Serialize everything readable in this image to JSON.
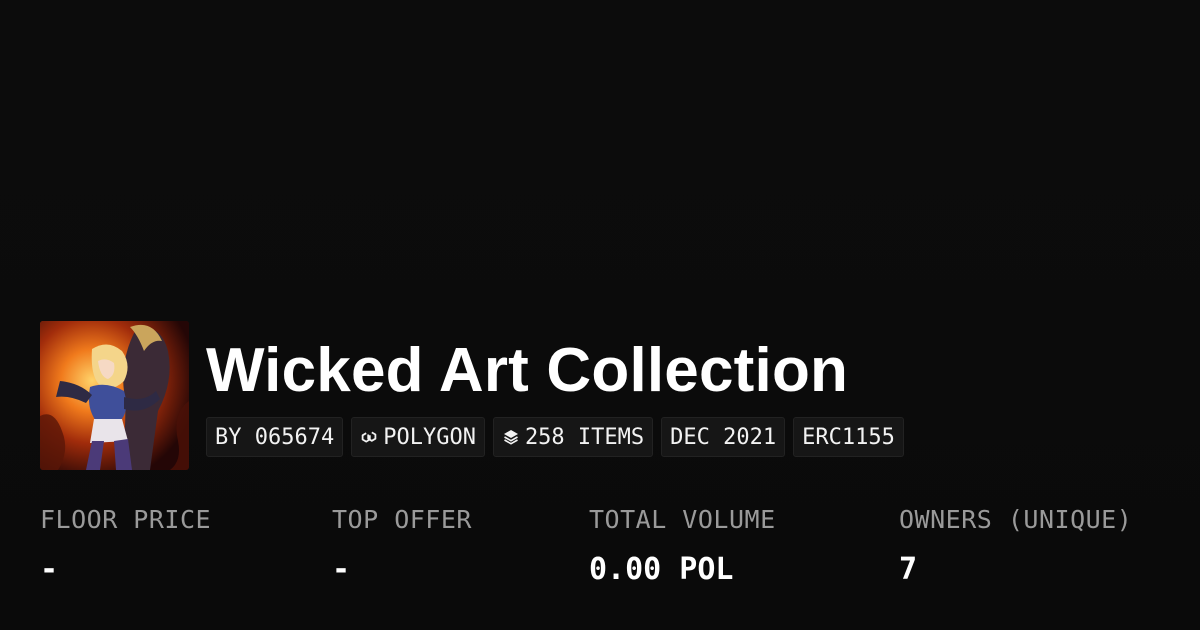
{
  "collection": {
    "title": "Wicked Art Collection",
    "thumbnail_alt": "collection-artwork"
  },
  "chips": [
    {
      "label": "BY 065674",
      "icon": ""
    },
    {
      "label": "POLYGON",
      "icon": "polygon-icon"
    },
    {
      "label": "258 ITEMS",
      "icon": "layers-icon"
    },
    {
      "label": "DEC 2021",
      "icon": ""
    },
    {
      "label": "ERC1155",
      "icon": ""
    }
  ],
  "stats": [
    {
      "label": "FLOOR PRICE",
      "value": "-"
    },
    {
      "label": "TOP OFFER",
      "value": "-"
    },
    {
      "label": "TOTAL VOLUME",
      "value": "0.00 POL"
    },
    {
      "label": "OWNERS (UNIQUE)",
      "value": "7"
    }
  ],
  "colors": {
    "background": "#0b0b0b",
    "chip_background": "#161616",
    "label_gray": "#9a9a9a",
    "text_white": "#ffffff"
  }
}
